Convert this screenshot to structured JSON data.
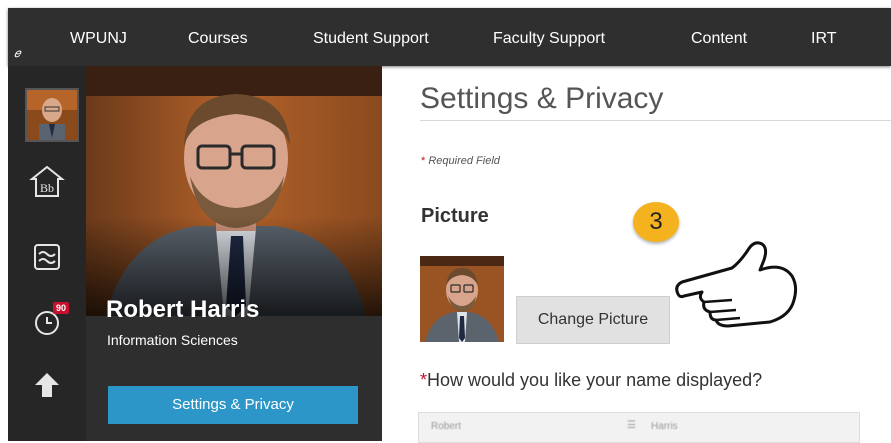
{
  "nav": {
    "items": [
      "WPUNJ",
      "Courses",
      "Student Support",
      "Faculty Support",
      "Content",
      "IRT"
    ]
  },
  "rail": {
    "notification_count": "90",
    "icons": [
      "avatar-thumbnail",
      "bb-home-icon",
      "stream-icon",
      "calendar-clock-icon",
      "grades-arrow-icon"
    ]
  },
  "profile": {
    "name": "Robert Harris",
    "department": "Information Sciences",
    "settings_button": "Settings & Privacy"
  },
  "main": {
    "title": "Settings & Privacy",
    "required_star": "*",
    "required_label": "Required Field",
    "picture_heading": "Picture",
    "change_picture_button": "Change Picture",
    "name_question": "How would you like your name displayed?",
    "name_row_left": "Robert",
    "name_row_right": "Harris"
  },
  "annotation": {
    "step_number": "3"
  },
  "colors": {
    "nav_bg": "#2f2f2f",
    "rail_bg": "#262626",
    "accent_blue": "#2d96c9",
    "badge_red": "#c8102e",
    "step_badge": "#f5b21f"
  }
}
